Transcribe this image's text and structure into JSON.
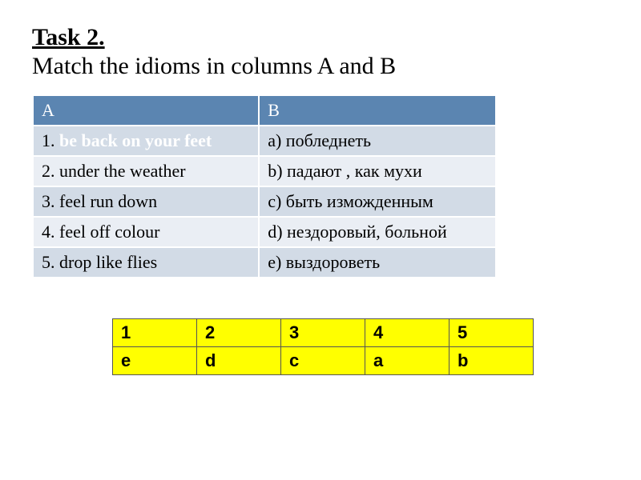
{
  "heading": {
    "task_label": "Task 2.",
    "subtitle": "Match the idioms in columns A  and B"
  },
  "match_table": {
    "header": {
      "colA": "A",
      "colB": "B"
    },
    "rows": [
      {
        "a_prefix": "1. ",
        "a_idiom": "be back on your feet",
        "b": "a) побледнеть"
      },
      {
        "a_prefix": "2. under the weather",
        "a_idiom": "",
        "b": "b) падают , как мухи"
      },
      {
        "a_prefix": "3. feel run down",
        "a_idiom": "",
        "b": "c) быть изможденным"
      },
      {
        "a_prefix": "4. feel off colour",
        "a_idiom": "",
        "b": "d) нездоровый, больной"
      },
      {
        "a_prefix": "5. drop like  flies",
        "a_idiom": "",
        "b": "e) выздороветь"
      }
    ]
  },
  "answers": {
    "numbers": [
      "1",
      "2",
      "3",
      "4",
      "5"
    ],
    "letters": [
      "e",
      "d",
      "c",
      "a",
      "b"
    ]
  },
  "chart_data": {
    "type": "table",
    "title": "Match the idioms in columns A and B",
    "columns": [
      "A",
      "B"
    ],
    "rows": [
      [
        "1. be back on your feet",
        "a) побледнеть"
      ],
      [
        "2. under the weather",
        "b) падают , как мухи"
      ],
      [
        "3. feel run down",
        "c) быть изможденным"
      ],
      [
        "4. feel off colour",
        "d) нездоровый, больной"
      ],
      [
        "5. drop like flies",
        "e) выздороветь"
      ]
    ],
    "answer_key": {
      "1": "e",
      "2": "d",
      "3": "c",
      "4": "a",
      "5": "b"
    }
  }
}
